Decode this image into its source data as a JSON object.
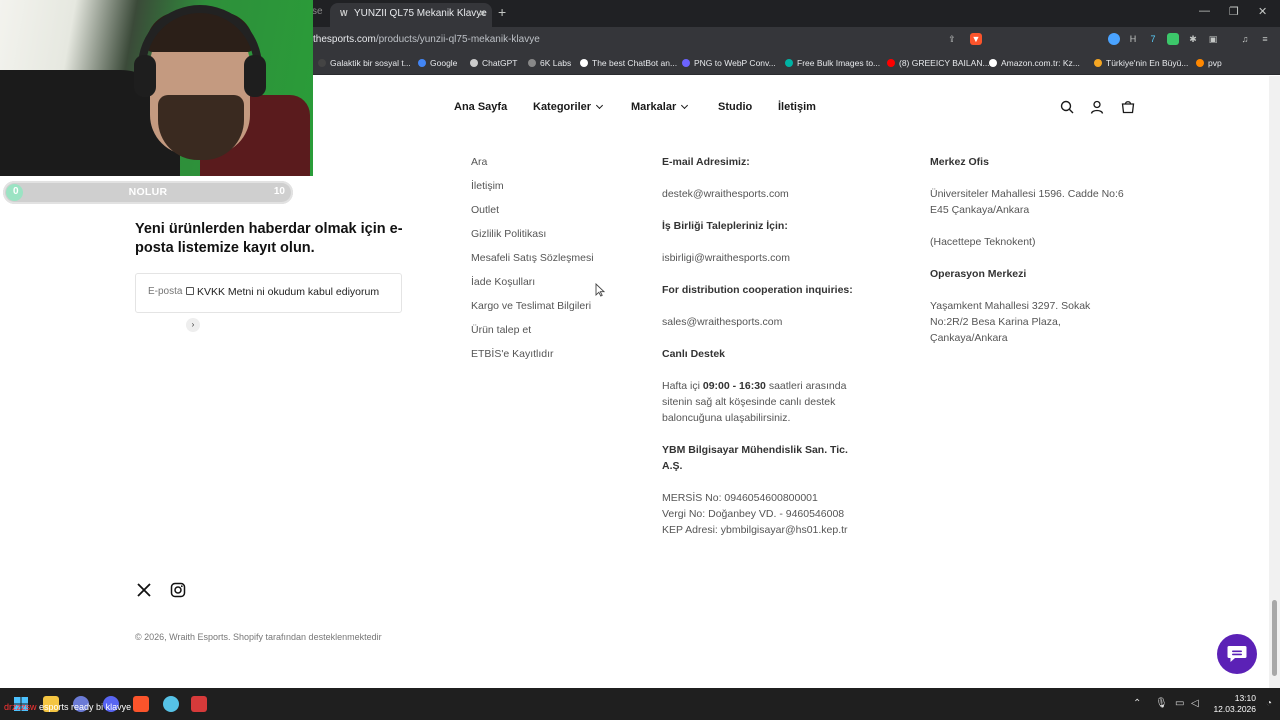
{
  "browser": {
    "ghost_tab": "se",
    "tab_title": "YUNZII QL75 Mekanik Klavye",
    "tab_favicon": "W",
    "url_domain": "thesports.com",
    "url_path": "/products/yunzii-ql75-mekanik-klavye",
    "bookmarks": [
      {
        "label": "Galaktik bir sosyal t...",
        "color": "#444444"
      },
      {
        "label": "Google",
        "color": "#4285f4"
      },
      {
        "label": "ChatGPT",
        "color": "#cccccc"
      },
      {
        "label": "6K Labs",
        "color": "#888888"
      },
      {
        "label": "The best ChatBot an...",
        "color": "#ffffff"
      },
      {
        "label": "PNG to WebP Conv...",
        "color": "#6c63ff"
      },
      {
        "label": "Free Bulk Images to...",
        "color": "#00b3a4"
      },
      {
        "label": "(8) GREEICY BAILAN...",
        "color": "#ff0000"
      },
      {
        "label": "Amazon.com.tr: Kz...",
        "color": "#ffffff"
      },
      {
        "label": "Türkiye'nin En Büyü...",
        "color": "#f5a623"
      },
      {
        "label": "pvp",
        "color": "#ff8800"
      }
    ]
  },
  "goal": {
    "label": "NOLUR",
    "min": "0",
    "max": "10",
    "progress": 0.04,
    "fill_color": "#9be3c3"
  },
  "nav": {
    "home": "Ana Sayfa",
    "categories": "Kategoriler",
    "brands": "Markalar",
    "studio": "Studio",
    "contact": "İletişim"
  },
  "newsletter": {
    "title": "Yeni ürünlerden haberdar olmak için e-posta listemize kayıt olun.",
    "email_placeholder": "E-posta",
    "kvkk_label": "KVKK Metni ni okudum kabul ediyorum",
    "submit_glyph": "›"
  },
  "footer_links": [
    "Ara",
    "İletişim",
    "Outlet",
    "Gizlilik Politikası",
    "Mesafeli Satış Sözleşmesi",
    "İade Koşulları",
    "Kargo ve Teslimat Bilgileri",
    "Ürün talep et",
    "ETBİS'e Kayıtlıdır"
  ],
  "contact": {
    "email_heading": "E-mail Adresimiz:",
    "email": "destek@wraithesports.com",
    "biz_heading": "İş Birliği Talepleriniz İçin:",
    "biz_email": "isbirligi@wraithesports.com",
    "dist_heading": "For distribution cooperation inquiries:",
    "dist_email": "sales@wraithesports.com",
    "support_heading": "Canlı Destek",
    "support_pre": "Hafta içi ",
    "support_hours": "09:00 - 16:30",
    "support_line1_post": " saatleri arasında",
    "support_line2": "sitenin sağ alt köşesinde canlı destek",
    "support_line3": "baloncuğuna ulaşabilirsiniz.",
    "company_line1": "YBM Bilgisayar Mühendislik San. Tic.",
    "company_line2": "A.Ş.",
    "mersis": "MERSİS No: 0946054600800001",
    "tax": "Vergi No: Doğanbey VD. - 9460546008",
    "kep": "KEP Adresi: ybmbilgisayar@hs01.kep.tr"
  },
  "offices": {
    "hq_heading": "Merkez Ofis",
    "hq_line1": "Üniversiteler Mahallesi 1596. Cadde No:6",
    "hq_line2": "E45 Çankaya/Ankara",
    "hq_line3": "(Hacettepe Teknokent)",
    "ops_heading": "Operasyon Merkezi",
    "ops_line1": "Yaşamkent Mahallesi 3297. Sokak",
    "ops_line2": "No:2R/2 Besa Karina Plaza,",
    "ops_line3": "Çankaya/Ankara"
  },
  "copyright": "© 2026, Wraith Esports. Shopify tarafından desteklenmektedir",
  "taskbar": {
    "overlay_red": "drzzzsw",
    "overlay_white": "esports ready bi klavye",
    "time": "13:10",
    "date": "12.03.2026"
  }
}
